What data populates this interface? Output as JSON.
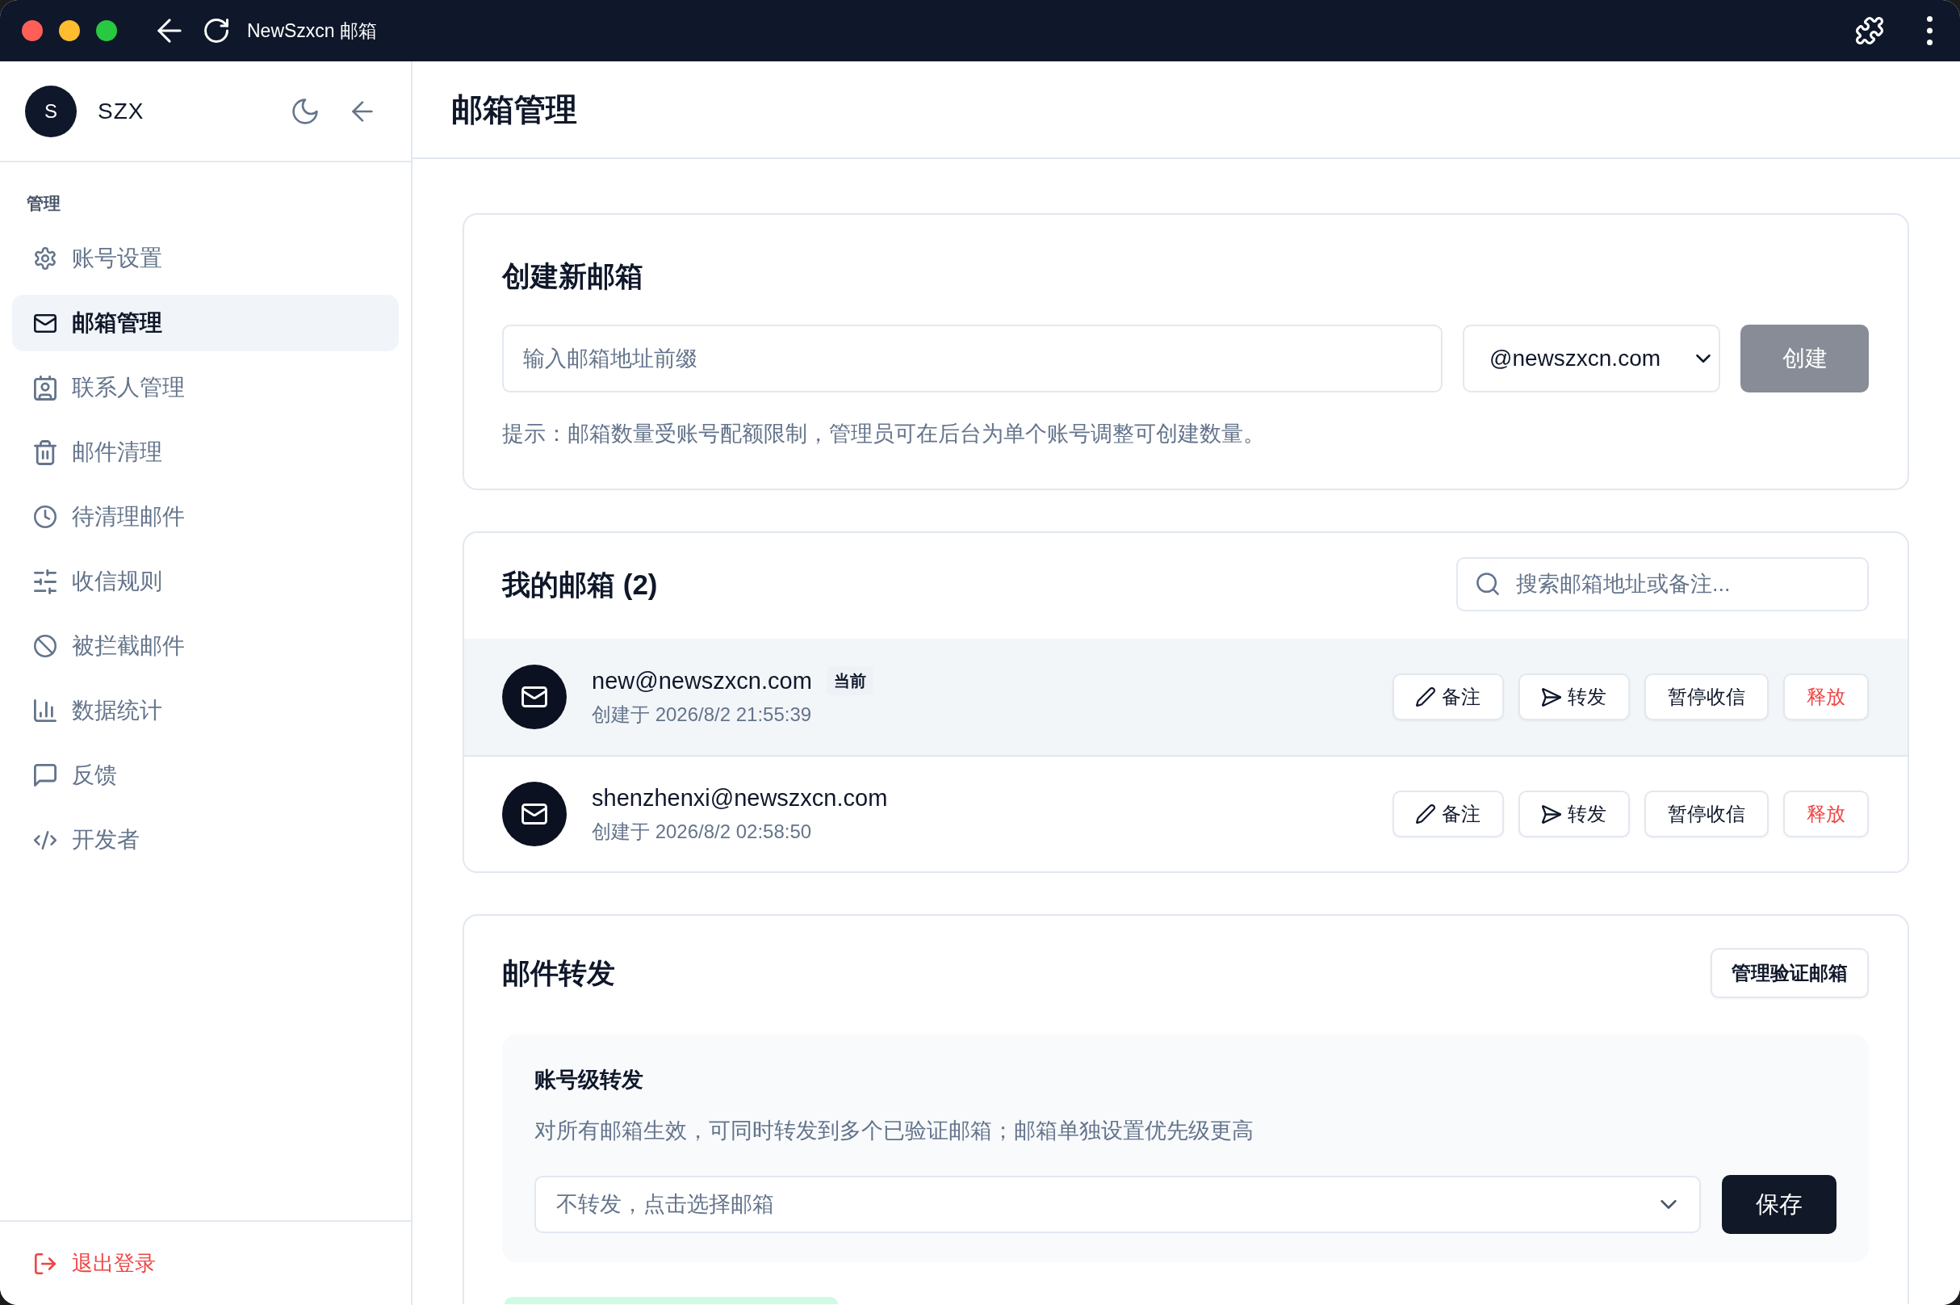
{
  "browser": {
    "title": "NewSzxcn 邮箱"
  },
  "sidebar": {
    "avatar_initial": "S",
    "user_name": "SZX",
    "section_label": "管理",
    "items": [
      {
        "label": "账号设置",
        "selected": false
      },
      {
        "label": "邮箱管理",
        "selected": true
      },
      {
        "label": "联系人管理",
        "selected": false
      },
      {
        "label": "邮件清理",
        "selected": false
      },
      {
        "label": "待清理邮件",
        "selected": false
      },
      {
        "label": "收信规则",
        "selected": false
      },
      {
        "label": "被拦截邮件",
        "selected": false
      },
      {
        "label": "数据统计",
        "selected": false
      },
      {
        "label": "反馈",
        "selected": false
      },
      {
        "label": "开发者",
        "selected": false
      }
    ],
    "logout": "退出登录"
  },
  "header": {
    "title": "邮箱管理"
  },
  "create_mailbox": {
    "title": "创建新邮箱",
    "prefix_field": {
      "placeholder": "输入邮箱地址前缀"
    },
    "domain_select": {
      "value": "@newszxcn.com"
    },
    "create_button": {
      "label": "创建",
      "disabled": true
    },
    "hint": "提示：邮箱数量受账号配额限制，管理员可在后台为单个账号调整可创建数量。"
  },
  "my_mailboxes": {
    "title": "我的邮箱 (2)",
    "search": {
      "placeholder": "搜索邮箱地址或备注..."
    },
    "rows": [
      {
        "address": "new@newszxcn.com",
        "badge": "当前",
        "created": "创建于 2026/8/2 21:55:39",
        "selected": true,
        "actions": [
          {
            "kind": "note",
            "label": "备注"
          },
          {
            "kind": "forward",
            "label": "转发"
          },
          {
            "kind": "pause",
            "label": "暂停收信"
          },
          {
            "kind": "release",
            "label": "释放"
          }
        ]
      },
      {
        "address": "shenzhenxi@newszxcn.com",
        "created": "创建于 2026/8/2 02:58:50",
        "selected": false,
        "actions": [
          {
            "kind": "note",
            "label": "备注"
          },
          {
            "kind": "forward",
            "label": "转发"
          },
          {
            "kind": "pause",
            "label": "暂停收信"
          },
          {
            "kind": "release",
            "label": "释放"
          }
        ]
      }
    ]
  },
  "forwarding": {
    "title": "邮件转发",
    "manage_button": "管理验证邮箱",
    "account_level": {
      "title": "账号级转发",
      "description": "对所有邮箱生效，可同时转发到多个已验证邮箱；邮箱单独设置优先级更高",
      "select": {
        "placeholder": "不转发，点击选择邮箱"
      },
      "save_button": "保存"
    }
  }
}
